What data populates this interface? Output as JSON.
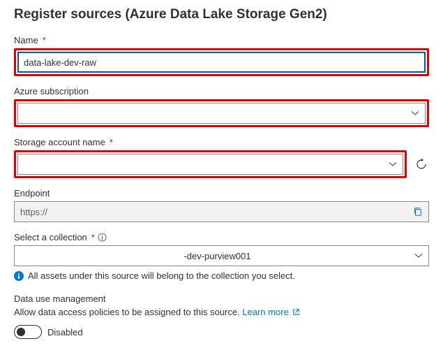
{
  "title": "Register sources (Azure Data Lake Storage Gen2)",
  "fields": {
    "name": {
      "label": "Name",
      "value": "data-lake-dev-raw"
    },
    "subscription": {
      "label": "Azure subscription",
      "value": ""
    },
    "storage_account": {
      "label": "Storage account name",
      "value": ""
    },
    "endpoint": {
      "label": "Endpoint",
      "value": "https://"
    },
    "collection": {
      "label": "Select a collection",
      "value": "-dev-purview001",
      "hint": "All assets under this source will belong to the collection you select."
    }
  },
  "data_use": {
    "heading": "Data use management",
    "desc": "Allow data access policies to be assigned to this source.",
    "learn_more": "Learn more",
    "toggle_state": "Disabled"
  }
}
